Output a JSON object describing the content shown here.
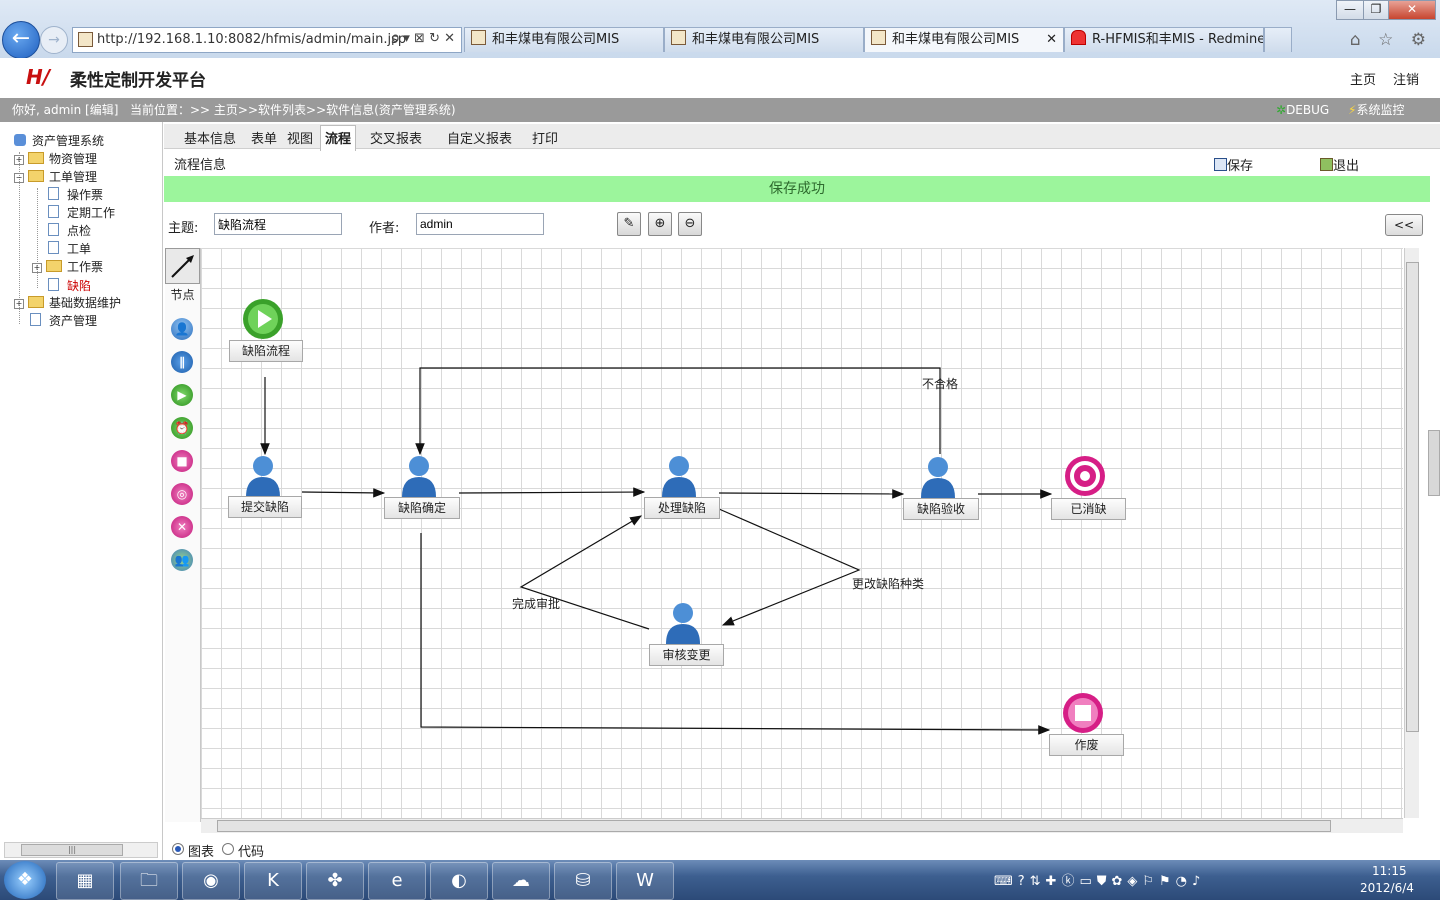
{
  "browser": {
    "url": "http://192.168.1.10:8082/hfmis/admin/main.jsp",
    "url_tools": "ρ ▾ ⊠ ↻ ✕",
    "tabs": [
      {
        "label": "和丰煤电有限公司MIS"
      },
      {
        "label": "和丰煤电有限公司MIS"
      },
      {
        "label": "和丰煤电有限公司MIS"
      },
      {
        "label": "R-HFMIS和丰MIS - Redmine"
      }
    ],
    "tab_close": "✕",
    "window_buttons": [
      "—",
      "❐",
      "✕"
    ],
    "right_icons": "⌂ ☆ ⚙"
  },
  "header": {
    "logo": "H/",
    "title": "柔性定制开发平台",
    "nav_home": "主页",
    "nav_logout": "注销"
  },
  "info_bar": {
    "greeting": "你好, admin [编辑]",
    "location": "当前位置：>> 主页>>软件列表>>软件信息(资产管理系统)",
    "debug": "DEBUG",
    "monitor": "系统监控"
  },
  "tree": {
    "root": "资产管理系统",
    "items": [
      {
        "label": "物资管理"
      },
      {
        "label": "工单管理"
      },
      {
        "label": "操作票"
      },
      {
        "label": "定期工作"
      },
      {
        "label": "点检"
      },
      {
        "label": "工单"
      },
      {
        "label": "工作票"
      },
      {
        "label": "缺陷"
      },
      {
        "label": "基础数据维护"
      },
      {
        "label": "资产管理"
      }
    ],
    "active_color": "#cc0000"
  },
  "main_tabs": [
    {
      "label": "基本信息"
    },
    {
      "label": "表单"
    },
    {
      "label": "视图"
    },
    {
      "label": "流程"
    },
    {
      "label": "交叉报表"
    },
    {
      "label": "自定义报表"
    },
    {
      "label": "打印"
    }
  ],
  "section": {
    "title": "流程信息",
    "save_label": "保存",
    "exit_label": "退出",
    "success_message": "保存成功"
  },
  "form": {
    "subject_label": "主题:",
    "subject_value": "缺陷流程",
    "author_label": "作者:",
    "author_value": "admin",
    "collapse_label": "<<"
  },
  "palette": {
    "nodes_label": "节点"
  },
  "flow": {
    "nodes": [
      {
        "label": "缺陷流程"
      },
      {
        "label": "提交缺陷"
      },
      {
        "label": "缺陷确定"
      },
      {
        "label": "处理缺陷"
      },
      {
        "label": "缺陷验收"
      },
      {
        "label": "已消缺"
      },
      {
        "label": "审核变更"
      },
      {
        "label": "作废"
      }
    ],
    "edge_labels": {
      "reject": "不合格",
      "change_type": "更改缺陷种类",
      "approved": "完成审批"
    }
  },
  "mode": {
    "chart_label": "图表",
    "code_label": "代码"
  },
  "taskbar": {
    "time": "11:15",
    "date": "2012/6/4"
  }
}
